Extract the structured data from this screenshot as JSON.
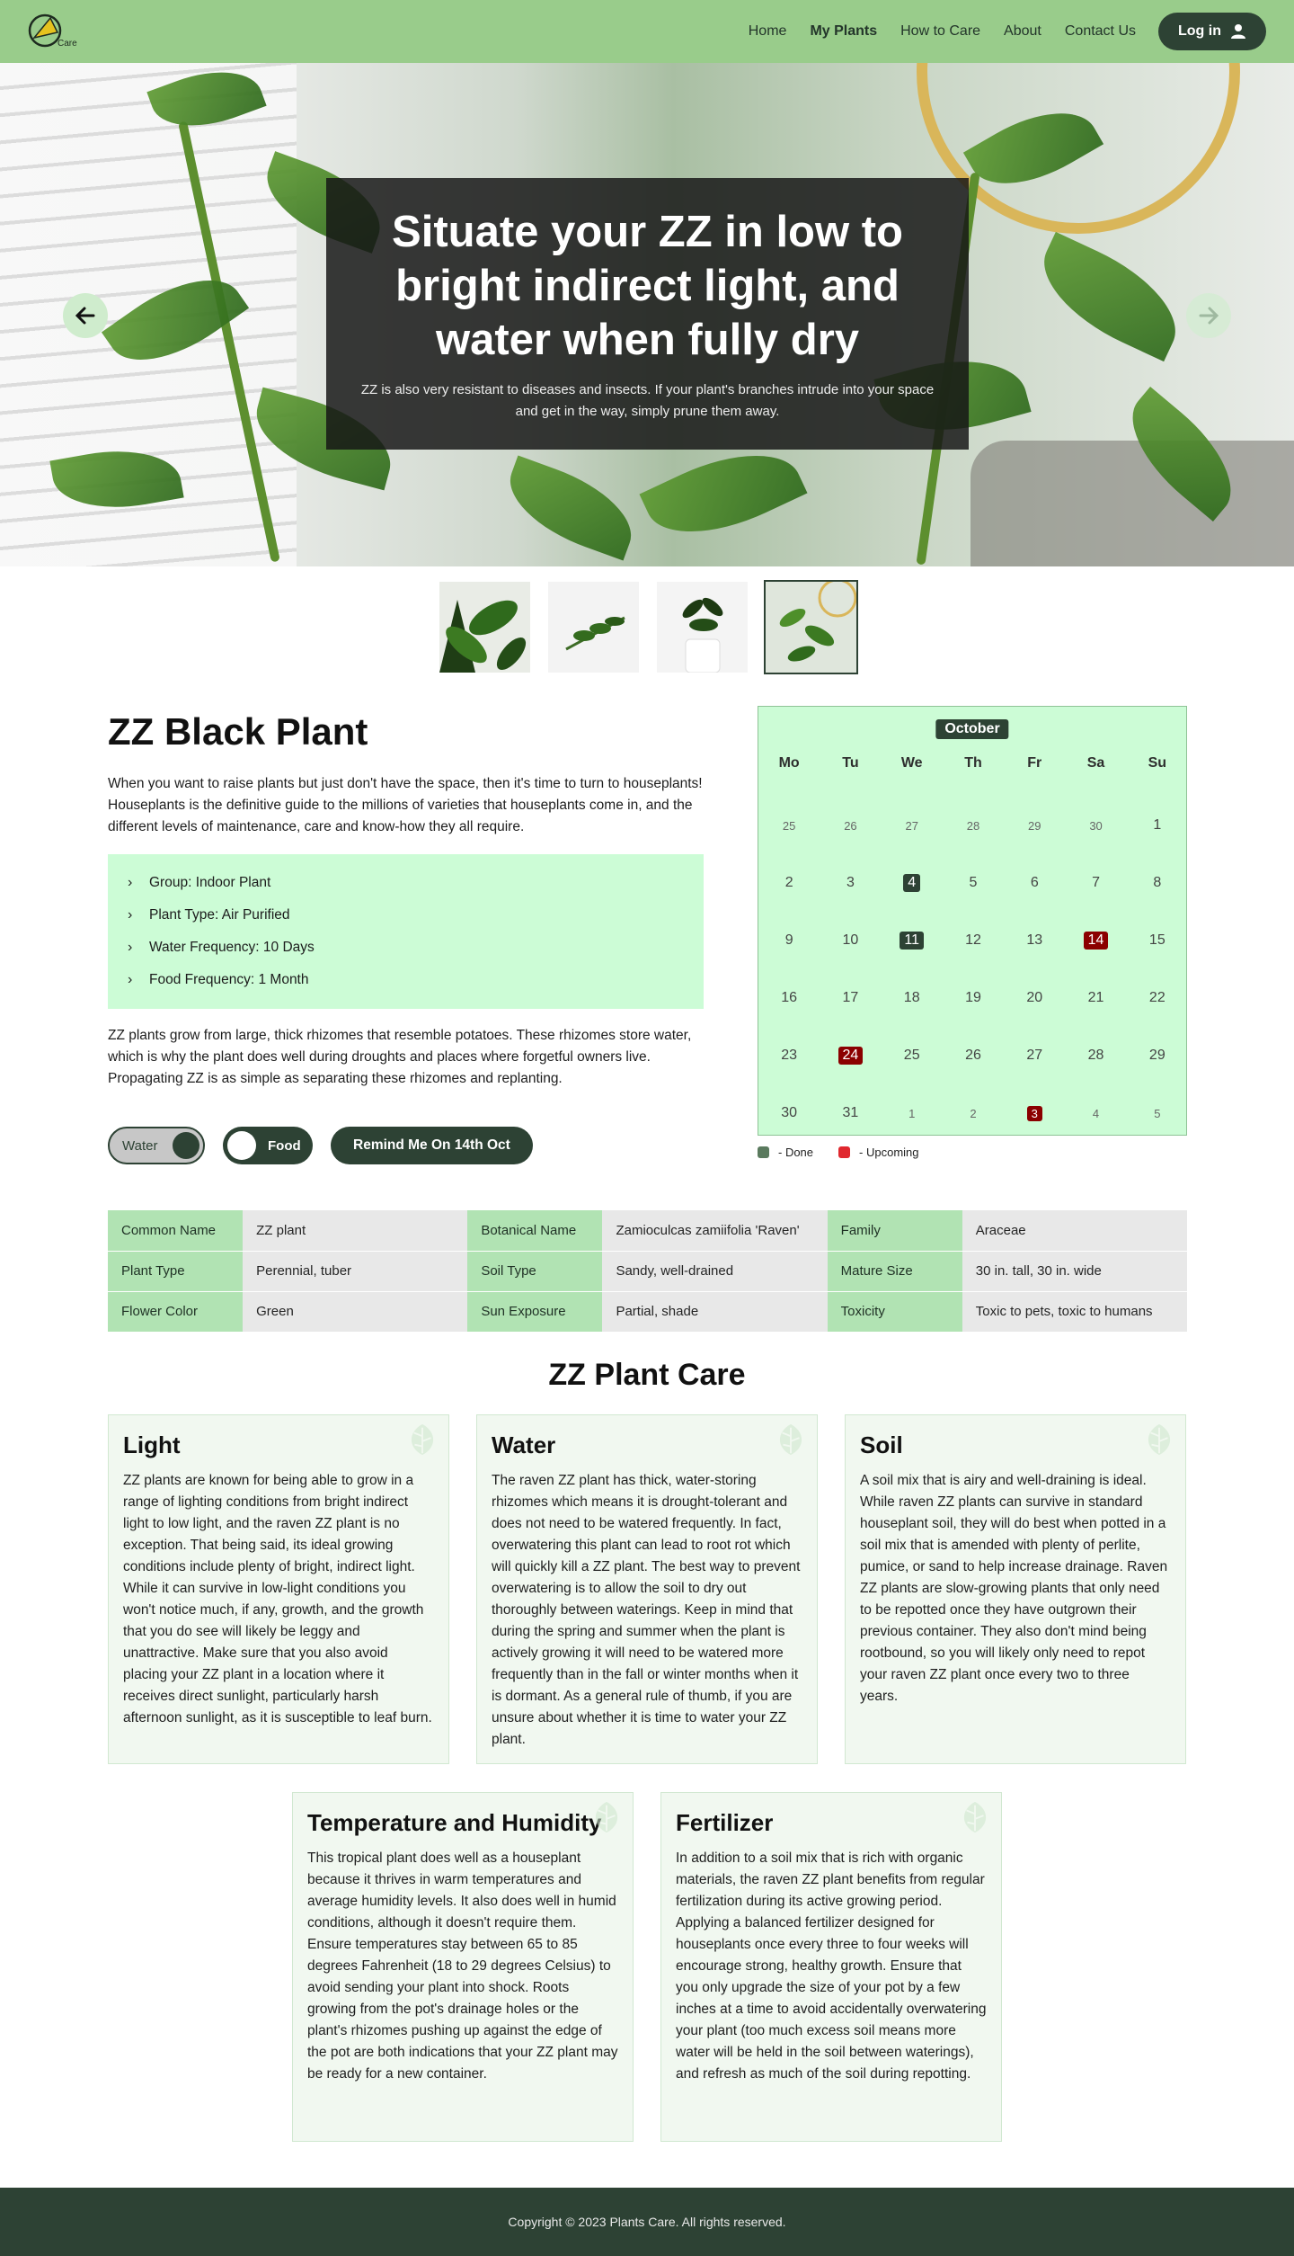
{
  "brand": {
    "logo_text": "Care"
  },
  "nav": {
    "links": [
      "Home",
      "My Plants",
      "How to Care",
      "About",
      "Contact Us"
    ],
    "active": "My Plants",
    "login_label": "Log in"
  },
  "hero": {
    "title": "Situate your ZZ in low to bright indirect light, and water when fully dry",
    "subtitle": "ZZ is also very resistant to diseases and insects. If your plant's branches intrude into your space and get in the way, simply prune them away.",
    "prev_icon": "arrow-left-icon",
    "next_icon": "arrow-right-icon"
  },
  "thumbnails": {
    "count": 4,
    "active_index": 3
  },
  "plant": {
    "title": "ZZ Black Plant",
    "intro": "When you want to raise plants but just don't have the space, then it's time to turn to houseplants! Houseplants is the definitive guide to the millions of varieties that houseplants come in, and the different levels of maintenance, care and know-how they all require.",
    "info": [
      "Group: Indoor Plant",
      "Plant Type: Air Purified",
      "Water Frequency: 10 Days",
      "Food Frequency: 1 Month"
    ],
    "description": "ZZ plants grow from large, thick rhizomes that resemble potatoes. These rhizomes store water, which is why the plant does well during droughts and places where forgetful owners live. Propagating ZZ is as simple as separating these rhizomes and replanting."
  },
  "controls": {
    "water_label": "Water",
    "food_label": "Food",
    "remind_label": "Remind Me On 14th Oct"
  },
  "calendar": {
    "month": "October",
    "weekdays": [
      "Mo",
      "Tu",
      "We",
      "Th",
      "Fr",
      "Sa",
      "Su"
    ],
    "rows": [
      [
        {
          "d": "25",
          "o": true
        },
        {
          "d": "26",
          "o": true
        },
        {
          "d": "27",
          "o": true
        },
        {
          "d": "28",
          "o": true
        },
        {
          "d": "29",
          "o": true
        },
        {
          "d": "30",
          "o": true
        },
        {
          "d": "1"
        }
      ],
      [
        {
          "d": "2"
        },
        {
          "d": "3"
        },
        {
          "d": "4",
          "m": "done"
        },
        {
          "d": "5"
        },
        {
          "d": "6"
        },
        {
          "d": "7"
        },
        {
          "d": "8"
        }
      ],
      [
        {
          "d": "9"
        },
        {
          "d": "10"
        },
        {
          "d": "11",
          "m": "done"
        },
        {
          "d": "12"
        },
        {
          "d": "13"
        },
        {
          "d": "14",
          "m": "up"
        },
        {
          "d": "15"
        }
      ],
      [
        {
          "d": "16"
        },
        {
          "d": "17"
        },
        {
          "d": "18"
        },
        {
          "d": "19"
        },
        {
          "d": "20"
        },
        {
          "d": "21"
        },
        {
          "d": "22"
        }
      ],
      [
        {
          "d": "23"
        },
        {
          "d": "24",
          "m": "up"
        },
        {
          "d": "25"
        },
        {
          "d": "26"
        },
        {
          "d": "27"
        },
        {
          "d": "28"
        },
        {
          "d": "29"
        }
      ],
      [
        {
          "d": "30"
        },
        {
          "d": "31"
        },
        {
          "d": "1",
          "o": true
        },
        {
          "d": "2",
          "o": true
        },
        {
          "d": "3",
          "o": true,
          "m": "up"
        },
        {
          "d": "4",
          "o": true
        },
        {
          "d": "5",
          "o": true
        }
      ]
    ],
    "legend_done": "- Done",
    "legend_upcoming": "- Upcoming",
    "colors": {
      "done": "#5a7a5e",
      "upcoming": "#e0282e"
    }
  },
  "facts": [
    [
      "Common Name",
      "ZZ plant",
      "Botanical Name",
      "Zamioculcas zamiifolia 'Raven'",
      "Family",
      "Araceae"
    ],
    [
      "Plant Type",
      "Perennial, tuber",
      "Soil Type",
      "Sandy, well-drained",
      "Mature Size",
      "30 in. tall, 30 in. wide"
    ],
    [
      "Flower Color",
      "Green",
      "Sun Exposure",
      "Partial, shade",
      "Toxicity",
      "Toxic to pets, toxic to humans"
    ]
  ],
  "care": {
    "title": "ZZ Plant Care",
    "cards": [
      {
        "title": "Light",
        "text": "ZZ plants are known for being able to grow in a range of lighting conditions from bright indirect light to low light, and the raven ZZ plant is no exception. That being said, its ideal growing conditions include plenty of bright, indirect light. While it can survive in low-light conditions you won't notice much, if any, growth, and the growth that you do see will likely be leggy and unattractive. Make sure that you also avoid placing your ZZ plant in a location where it receives direct sunlight, particularly harsh afternoon sunlight, as it is susceptible to leaf burn."
      },
      {
        "title": "Water",
        "text": "The raven ZZ plant has thick, water-storing rhizomes which means it is drought-tolerant and does not need to be watered frequently. In fact, overwatering this plant can lead to root rot which will quickly kill a ZZ plant. The best way to prevent overwatering is to allow the soil to dry out thoroughly between waterings. Keep in mind that during the spring and summer when the plant is actively growing it will need to be watered more frequently than in the fall or winter months when it is dormant. As a general rule of thumb, if you are unsure about whether it is time to water your ZZ plant."
      },
      {
        "title": "Soil",
        "text": "A soil mix that is airy and well-draining is ideal. While raven ZZ plants can survive in standard houseplant soil, they will do best when potted in a soil mix that is amended with plenty of perlite, pumice, or sand to help increase drainage. Raven ZZ plants are slow-growing plants that only need to be repotted once they have outgrown their previous container. They also don't mind being rootbound, so you will likely only need to repot your raven ZZ plant once every two to three years."
      },
      {
        "title": "Temperature and Humidity",
        "text": "This tropical plant does well as a houseplant because it thrives in warm temperatures and average humidity levels. It also does well in humid conditions, although it doesn't require them. Ensure temperatures stay between 65 to 85 degrees Fahrenheit (18 to 29 degrees Celsius) to avoid sending your plant into shock. Roots growing from the pot's drainage holes or the plant's rhizomes pushing up against the edge of the pot are both indications that your ZZ plant may be ready for a new container."
      },
      {
        "title": "Fertilizer",
        "text": "In addition to a soil mix that is rich with organic materials, the raven ZZ plant benefits from regular fertilization during its active growing period. Applying a balanced fertilizer designed for houseplants once every three to four weeks will encourage strong, healthy growth. Ensure that you only upgrade the size of your pot by a few inches at a time to avoid accidentally overwatering your plant (too much excess soil means more water will be held in the soil between waterings), and refresh as much of the soil during repotting."
      }
    ]
  },
  "footer": {
    "copyright": "Copyright © 2023 Plants Care. All rights reserved."
  }
}
